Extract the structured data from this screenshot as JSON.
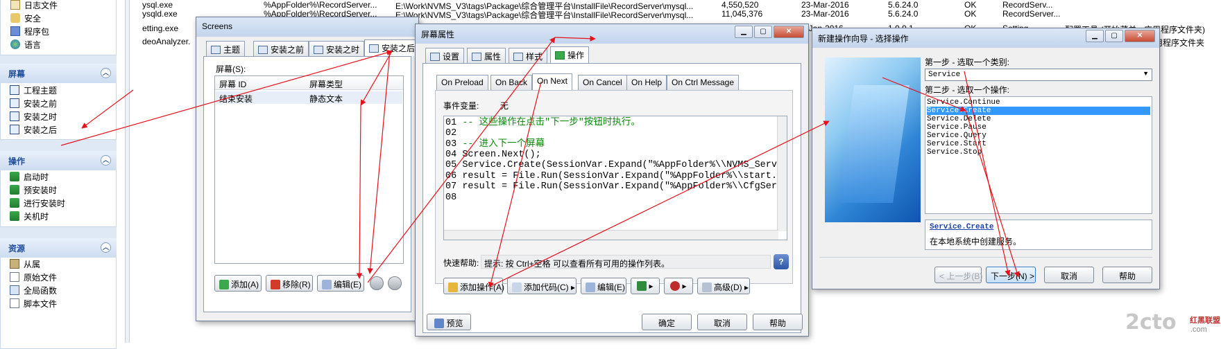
{
  "left_panel": {
    "top_items": [
      {
        "label": "日志文件",
        "icon": "log-icon"
      },
      {
        "label": "安全",
        "icon": "security-icon"
      },
      {
        "label": "程序包",
        "icon": "package-icon"
      },
      {
        "label": "语言",
        "icon": "globe-icon"
      }
    ],
    "screens": {
      "title": "屏幕",
      "items": [
        "工程主题",
        "安装之前",
        "安装之时",
        "安装之后"
      ]
    },
    "actions": {
      "title": "操作",
      "items": [
        "启动时",
        "预安装时",
        "进行安装时",
        "关机时"
      ]
    },
    "resources": {
      "title": "资源",
      "items": [
        "从属",
        "原始文件",
        "全局函数",
        "脚本文件"
      ]
    }
  },
  "background_rows": [
    {
      "name": "ysql.exe",
      "path": "%AppFolder%\\RecordServer...",
      "src": "E:\\Work\\NVMS_V3\\tags\\Package\\综合管理平台\\InstallFile\\RecordServer\\mysql...",
      "size": "4,550,520",
      "date": "23-Mar-2016",
      "ver": "5.6.24.0",
      "status": "OK",
      "type": "RecordServ..."
    },
    {
      "name": "ysqld.exe",
      "path": "%AppFolder%\\RecordServer...",
      "src": "E:\\Work\\NVMS_V3\\tags\\Package\\综合管理平台\\InstallFile\\RecordServer\\mysql...",
      "size": "11,045,376",
      "date": "23-Mar-2016",
      "ver": "5.6.24.0",
      "status": "OK",
      "type": "RecordServer..."
    },
    {
      "name": "etting.exe",
      "path": "",
      "src": "",
      "size": "",
      "date": "8-Jan-2016",
      "ver": "1.0.0.1",
      "status": "OK",
      "type": "Setting",
      "extra": "配置工具 (开始菜单 - 应用程序文件夹)"
    },
    {
      "name": "deoAnalyzer.",
      "path": "",
      "src": "",
      "size": "",
      "date": "",
      "ver": "",
      "status": "",
      "type": "",
      "extra": ">应用程序文件夹"
    }
  ],
  "screens_window": {
    "title": "Screens",
    "tabs": [
      "主题",
      "安装之前",
      "安装之时",
      "安装之后"
    ],
    "list_label": "屏幕(S):",
    "columns": [
      "屏幕 ID",
      "屏幕类型"
    ],
    "rows": [
      [
        "结束安装",
        "静态文本"
      ]
    ],
    "buttons": {
      "add": "添加(A)",
      "remove": "移除(R)",
      "edit": "编辑(E)"
    }
  },
  "props_window": {
    "title": "屏幕属性",
    "tabs": [
      "设置",
      "属性",
      "样式",
      "操作"
    ],
    "subtabs": [
      "On Preload",
      "On Back",
      "On Next",
      "On Cancel",
      "On Help",
      "On Ctrl Message"
    ],
    "event_label": "事件变量:",
    "event_value": "无",
    "code_lines": [
      {
        "num": "01",
        "text": "-- 这些操作在点击\"下一步\"按钮时执行。"
      },
      {
        "num": "02",
        "text": ""
      },
      {
        "num": "03",
        "text": "-- 进入下一个屏幕"
      },
      {
        "num": "04",
        "text": "Screen.Next();"
      },
      {
        "num": "05",
        "text": "Service.Create(SessionVar.Expand(\"%AppFolder%\\\\NVMS_Serv"
      },
      {
        "num": "06",
        "text": "result = File.Run(SessionVar.Expand(\"%AppFolder%\\\\start."
      },
      {
        "num": "07",
        "text": "result = File.Run(SessionVar.Expand(\"%AppFolder%\\\\CfgSer"
      },
      {
        "num": "08",
        "text": ""
      }
    ],
    "help_label": "快速帮助:",
    "help_text": "提示: 按 Ctrl+空格 可以查看所有可用的操作列表。",
    "buttons": {
      "add_action": "添加操作(A)",
      "add_code": "添加代码(C)",
      "edit": "编辑(E)",
      "advanced": "高级(D)",
      "preview": "预览",
      "ok": "确定",
      "cancel": "取消",
      "help": "帮助"
    }
  },
  "wizard_window": {
    "title": "新建操作向导 - 选择操作",
    "step1": "第一步 - 选取一个类别:",
    "category": "Service",
    "step2": "第二步 - 选取一个操作:",
    "actions": [
      "Service.Continue",
      "Service.Create",
      "Service.Delete",
      "Service.Pause",
      "Service.Query",
      "Service.Start",
      "Service.Stop"
    ],
    "selected_index": 1,
    "desc_link": "Service.Create",
    "desc_text": "在本地系统中创建服务。",
    "buttons": {
      "prev": "< 上一步(B)",
      "next": "下一步(N) >",
      "cancel": "取消",
      "help": "帮助"
    }
  },
  "watermark": {
    "text": "2cto",
    "sub": "红黑联盟",
    "site": ".com"
  },
  "colors": {
    "accent": "#1e4d9a",
    "selected": "#3399ff",
    "arrow": "#e8101a"
  }
}
